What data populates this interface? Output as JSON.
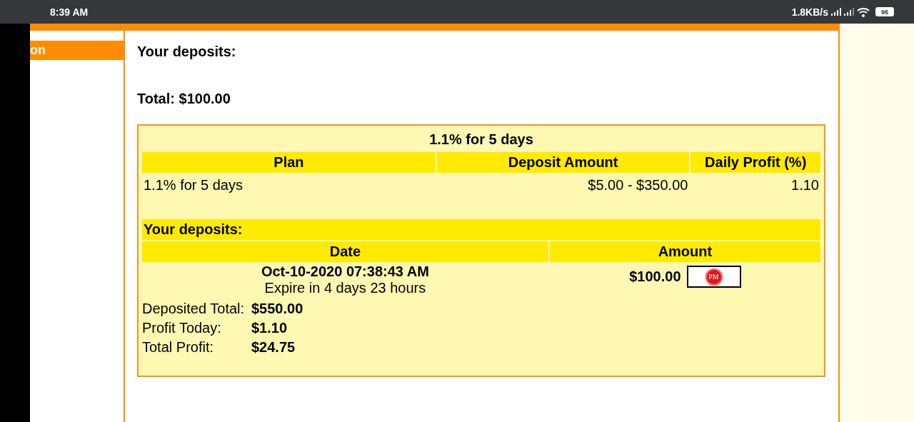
{
  "status_bar": {
    "time": "8:39 AM",
    "speed": "1.8KB/s",
    "battery": "96"
  },
  "sidebar": {
    "items": [
      {
        "label": "on",
        "selected": true
      }
    ]
  },
  "main": {
    "heading": "Your deposits:",
    "total": "Total: $100.00",
    "plan_box": {
      "title": "1.1% for 5 days",
      "columns": [
        "Plan",
        "Deposit Amount",
        "Daily Profit (%)"
      ],
      "rows": [
        [
          "1.1% for 5 days",
          "$5.00 - $350.00",
          "1.10"
        ]
      ],
      "deposits": {
        "heading": "Your deposits:",
        "columns": [
          "Date",
          "Amount"
        ],
        "rows": [
          {
            "date": "Oct-10-2020 07:38:43 AM",
            "expire": "Expire in 4 days 23 hours",
            "amount": "$100.00",
            "processor": "PM"
          }
        ]
      },
      "summary": [
        {
          "label": "Deposited Total:",
          "value": "$550.00"
        },
        {
          "label": "Profit Today:",
          "value": "$1.10"
        },
        {
          "label": "Total Profit:",
          "value": "$24.75"
        }
      ]
    }
  }
}
